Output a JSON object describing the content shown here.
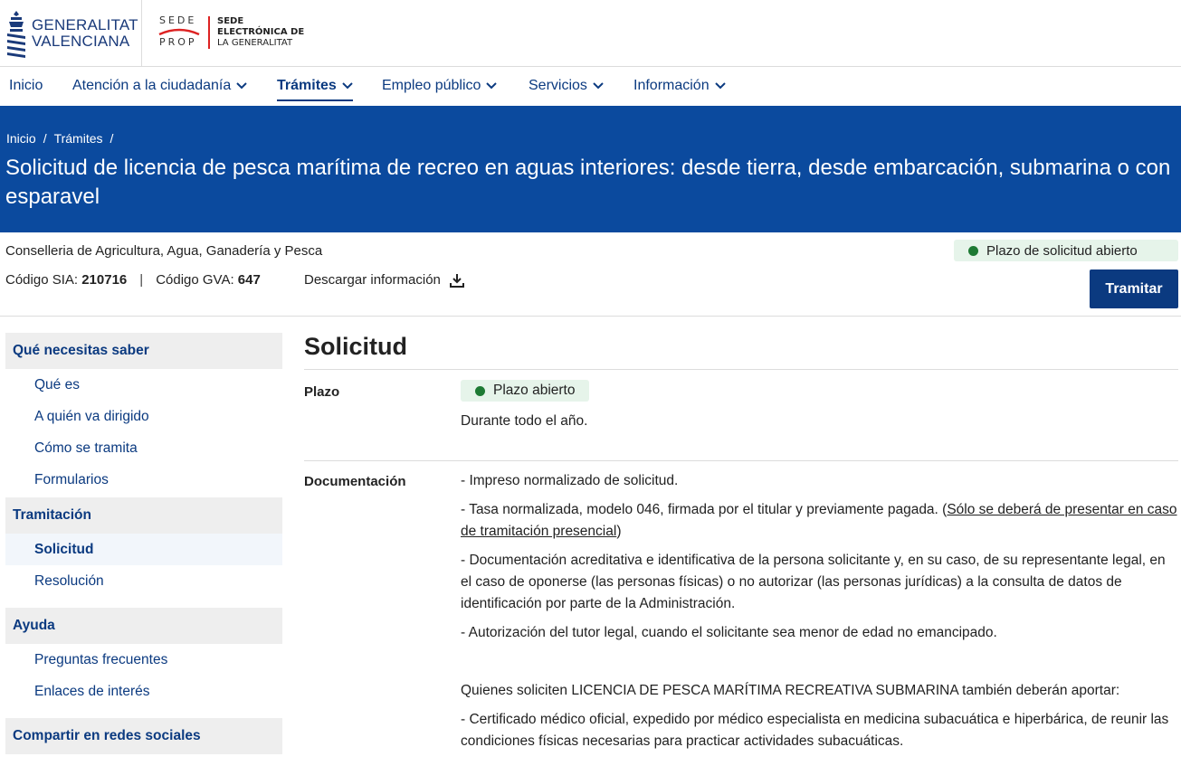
{
  "header": {
    "gv_logo_lines": [
      "GENERALITAT",
      "VALENCIANA"
    ],
    "sede_logo": {
      "left_top": "SEDE",
      "left_bottom": "PROP",
      "right_lines": [
        "SEDE",
        "ELECTRÓNICA DE",
        "LA GENERALITAT"
      ]
    }
  },
  "nav": [
    {
      "label": "Inicio",
      "has_dropdown": false
    },
    {
      "label": "Atención a la ciudadanía",
      "has_dropdown": true
    },
    {
      "label": "Trámites",
      "has_dropdown": true,
      "active": true
    },
    {
      "label": "Empleo público",
      "has_dropdown": true
    },
    {
      "label": "Servicios",
      "has_dropdown": true
    },
    {
      "label": "Información",
      "has_dropdown": true
    }
  ],
  "breadcrumb": [
    "Inicio",
    "/",
    "Trámites",
    "/"
  ],
  "page_title": "Solicitud de licencia de pesca marítima de recreo en aguas interiores: desde tierra, desde embarcación, submarina o con esparavel",
  "info": {
    "department": "Conselleria de Agricultura, Agua, Ganadería y Pesca",
    "sia_label": "Código SIA:",
    "sia_value": "210716",
    "separator": "|",
    "gva_label": "Código GVA:",
    "gva_value": "647",
    "download_label": "Descargar información",
    "status_badge": "Plazo de solicitud abierto",
    "tramitar_label": "Tramitar"
  },
  "sidebar": {
    "sections": [
      {
        "title": "Qué necesitas saber",
        "links": [
          "Qué es",
          "A quién va dirigido",
          "Cómo se tramita",
          "Formularios"
        ]
      },
      {
        "title": "Tramitación",
        "links": [
          "Solicitud",
          "Resolución"
        ],
        "active_link": "Solicitud"
      },
      {
        "title": "Ayuda",
        "links": [
          "Preguntas frecuentes",
          "Enlaces de interés"
        ]
      },
      {
        "title": "Compartir en redes sociales",
        "links": []
      }
    ]
  },
  "main": {
    "heading": "Solicitud",
    "plazo": {
      "label": "Plazo",
      "badge": "Plazo abierto",
      "text": "Durante todo el año."
    },
    "documentacion": {
      "label": "Documentación",
      "items": [
        "- Impreso normalizado de solicitud.",
        "- Tasa normalizada, modelo 046, firmada por el titular y previamente pagada. (",
        "- Documentación acreditativa e identificativa de la persona solicitante y, en su caso, de su representante legal, en el caso de oponerse (las personas físicas) o no autorizar (las personas jurídicas) a la consulta de datos de identificación por parte de la Administración.",
        "- Autorización del tutor legal, cuando el solicitante sea menor de edad no emancipado."
      ],
      "tasa_link": "Sólo se deberá de presentar en caso de tramitación presencial",
      "tasa_close": ")",
      "submarina_intro": "Quienes soliciten LICENCIA DE PESCA MARÍTIMA RECREATIVA SUBMARINA también deberán aportar:",
      "submarina_item": "- Certificado médico oficial, expedido por médico especialista en medicina subacuática e hiperbárica, de reunir las condiciones físicas necesarias para practicar actividades subacuáticas."
    }
  },
  "colors": {
    "brand_blue": "#0b4a9e",
    "nav_blue": "#0b3a80",
    "status_green": "#1e7a34",
    "badge_bg": "#e6f4ea"
  }
}
